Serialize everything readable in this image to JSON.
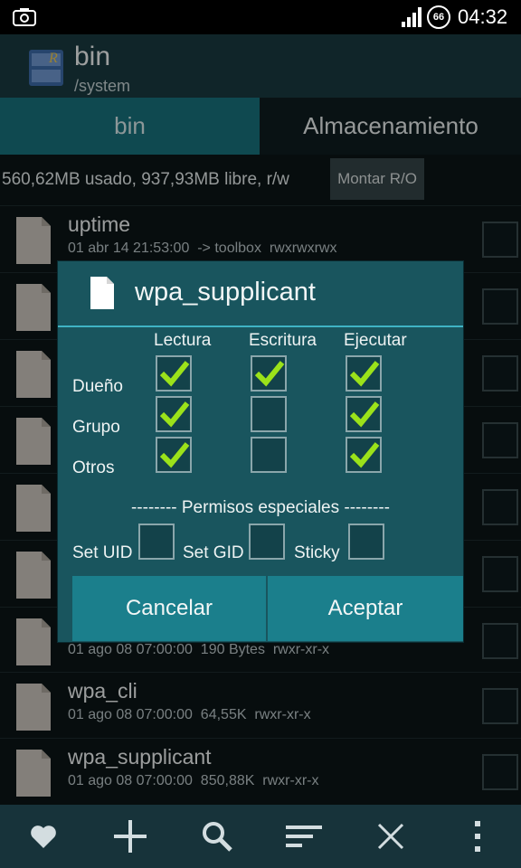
{
  "status_bar": {
    "time": "04:32",
    "battery": "66"
  },
  "action_bar": {
    "title": "bin",
    "subtitle": "/system"
  },
  "tabs": [
    {
      "label": "bin",
      "active": true
    },
    {
      "label": "Almacenamiento",
      "active": false
    }
  ],
  "info_bar": {
    "usage": "560,62MB usado, 937,93MB libre, r/w",
    "mount_button": "Montar R/O"
  },
  "files": [
    {
      "name": "uptime",
      "meta": "01 abr 14 21:53:00  -> toolbox  rwxrwxrwx"
    },
    {
      "name": "",
      "meta": ""
    },
    {
      "name": "",
      "meta": ""
    },
    {
      "name": "",
      "meta": ""
    },
    {
      "name": "",
      "meta": ""
    },
    {
      "name": "",
      "meta": ""
    },
    {
      "name": "",
      "meta": "01 ago 08 07:00:00  190 Bytes  rwxr-xr-x"
    },
    {
      "name": "wpa_cli",
      "meta": "01 ago 08 07:00:00  64,55K  rwxr-xr-x"
    },
    {
      "name": "wpa_supplicant",
      "meta": "01 ago 08 07:00:00  850,88K  rwxr-xr-x"
    }
  ],
  "dialog": {
    "title": "wpa_supplicant",
    "columns": [
      "Lectura",
      "Escritura",
      "Ejecutar"
    ],
    "rows": [
      {
        "label": "Dueño",
        "checks": [
          true,
          true,
          true
        ]
      },
      {
        "label": "Grupo",
        "checks": [
          true,
          false,
          true
        ]
      },
      {
        "label": "Otros",
        "checks": [
          true,
          false,
          true
        ]
      }
    ],
    "special_header": "-------- Permisos especiales --------",
    "special": [
      {
        "label": "Set UID",
        "checked": false
      },
      {
        "label": "Set GID",
        "checked": false
      },
      {
        "label": "Sticky",
        "checked": false
      }
    ],
    "cancel_label": "Cancelar",
    "accept_label": "Aceptar"
  },
  "bottom_bar": {
    "icons": [
      "heart-icon",
      "plus-icon",
      "search-icon",
      "sort-icon",
      "close-icon",
      "overflow-menu-icon"
    ]
  },
  "colors": {
    "accent": "#17707c",
    "check": "#9be21a",
    "dialog_bg": "#19555e"
  }
}
